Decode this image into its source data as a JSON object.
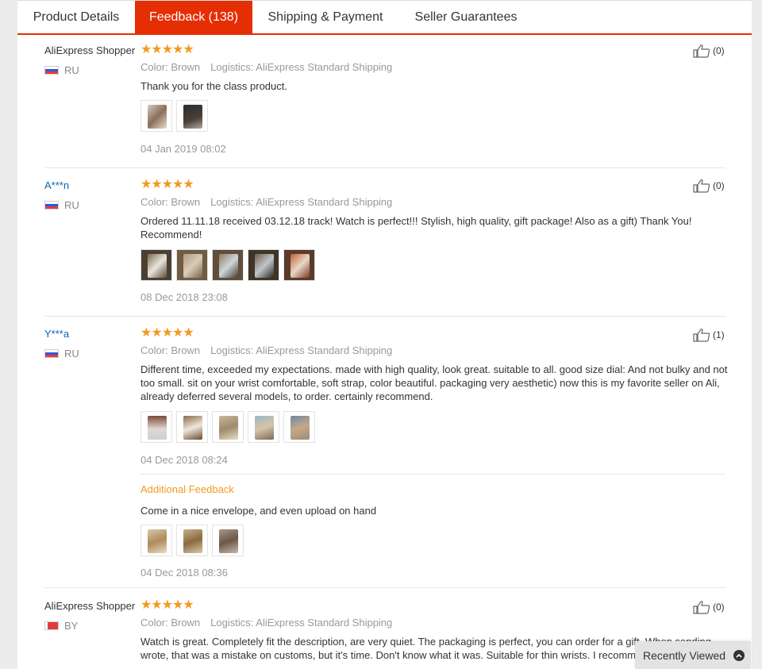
{
  "tabs": [
    {
      "label": "Product Details",
      "active": false
    },
    {
      "label": "Feedback (138)",
      "active": true
    },
    {
      "label": "Shipping & Payment",
      "active": false
    },
    {
      "label": "Seller Guarantees",
      "active": false
    }
  ],
  "labels": {
    "color": "Color:",
    "logistics": "Logistics:",
    "additional_feedback": "Additional Feedback",
    "stars": "★★★★★"
  },
  "reviews": [
    {
      "name": "AliExpress Shopper",
      "country": "RU",
      "color": "Brown",
      "logistics": "AliExpress Standard Shipping",
      "text": "Thank you for the class product.",
      "likes": "(0)",
      "date": "04 Jan 2019 08:02",
      "photos": 2
    },
    {
      "name": "A***n",
      "country": "RU",
      "color": "Brown",
      "logistics": "AliExpress Standard Shipping",
      "text": "Ordered 11.11.18 received 03.12.18 track! Watch is perfect!!! Stylish, high quality, gift package! Also as a gift) Thank You! Recommend!",
      "likes": "(0)",
      "date": "08 Dec 2018 23:08",
      "photos": 5
    },
    {
      "name": "Y***a",
      "country": "RU",
      "color": "Brown",
      "logistics": "AliExpress Standard Shipping",
      "text": "Different time, exceeded my expectations. made with high quality, look great. suitable to all. good size dial: And not bulky and not too small. sit on your wrist comfortable, soft strap, color beautiful. packaging very aesthetic) now this is my favorite seller on Ali, already deferred several models, to order. certainly recommend.",
      "likes": "(1)",
      "date": "04 Dec 2018 08:24",
      "photos": 5,
      "additional": {
        "text": "Come in a nice envelope, and even upload on hand",
        "date": "04 Dec 2018 08:36",
        "photos": 3
      }
    },
    {
      "name": "AliExpress Shopper",
      "country": "BY",
      "color": "Brown",
      "logistics": "AliExpress Standard Shipping",
      "text": "Watch is great. Completely fit the description, are very quiet. The packaging is perfect, you can order for a gift. When sending wrote, that was a mistake on customs, but it's time. Don't know what it was. Suitable for thin wrists. I recommend.",
      "likes": "(0)"
    }
  ],
  "recently_viewed": "Recently Viewed",
  "colors": {
    "accent": "#e62e04",
    "star": "#f29a1f",
    "link": "#0a64b4"
  }
}
